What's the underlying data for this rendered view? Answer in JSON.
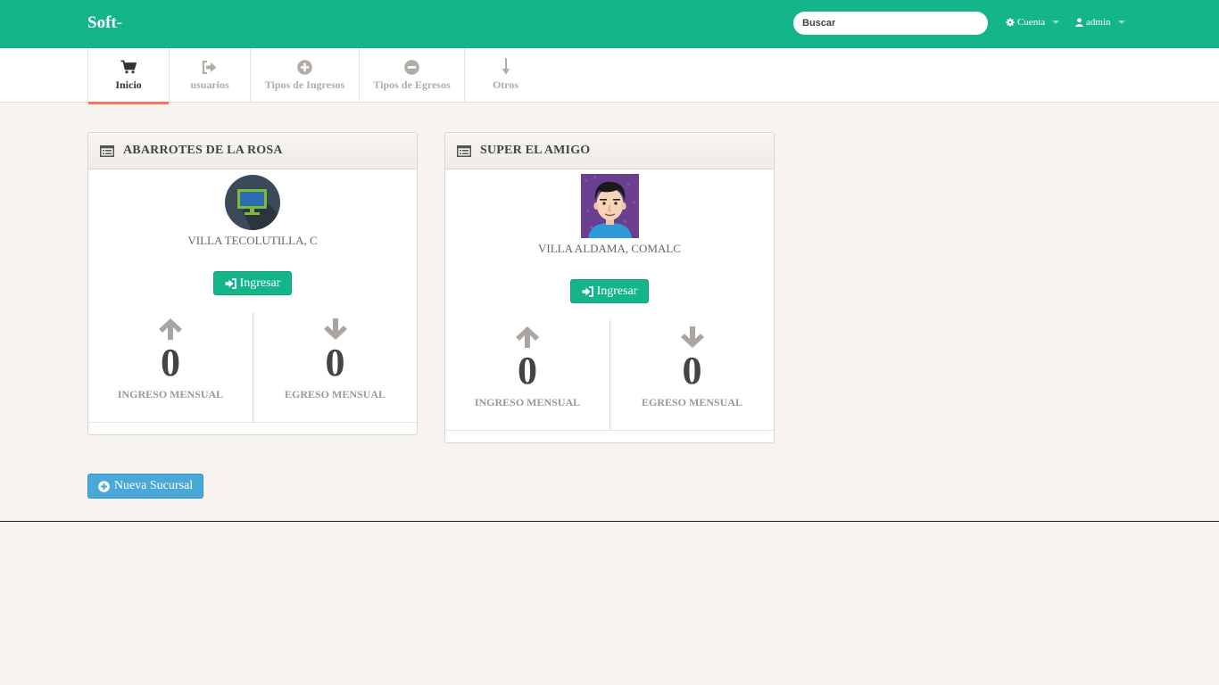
{
  "app": {
    "brand": "Soft",
    "brand_suffix": "-"
  },
  "topnav": {
    "search_placeholder": "Buscar",
    "account_label": "Cuenta",
    "user_label": "admin"
  },
  "tabs": [
    {
      "label": "Inicio",
      "icon": "cart-icon",
      "active": true
    },
    {
      "label": "usuarios",
      "icon": "sign-out-icon",
      "active": false
    },
    {
      "label": "Tipos de Ingresos",
      "icon": "plus-circle-icon",
      "active": false
    },
    {
      "label": "Tipos de Egresos",
      "icon": "minus-circle-icon",
      "active": false
    },
    {
      "label": "Otros",
      "icon": "arrow-down-icon",
      "active": false
    }
  ],
  "branches": [
    {
      "name": "ABARROTES DE LA ROSA",
      "avatar": "monitor-icon",
      "location": "VILLA TECOLUTILLA, C",
      "button_label": "Ingresar",
      "ingreso_value": "0",
      "ingreso_label": "INGRESO MENSUAL",
      "egreso_value": "0",
      "egreso_label": "EGRESO MENSUAL"
    },
    {
      "name": "SUPER EL AMIGO",
      "avatar": "person-avatar",
      "location": "VILLA ALDAMA, COMALC",
      "button_label": "Ingresar",
      "ingreso_value": "0",
      "ingreso_label": "INGRESO MENSUAL",
      "egreso_value": "0",
      "egreso_label": "EGRESO MENSUAL"
    }
  ],
  "actions": {
    "new_branch_label": "Nueva Sucursal"
  },
  "colors": {
    "primary": "#14b58b",
    "accent_tab": "#f0785e",
    "info": "#4aa8d8",
    "background": "#f7f4ef"
  }
}
